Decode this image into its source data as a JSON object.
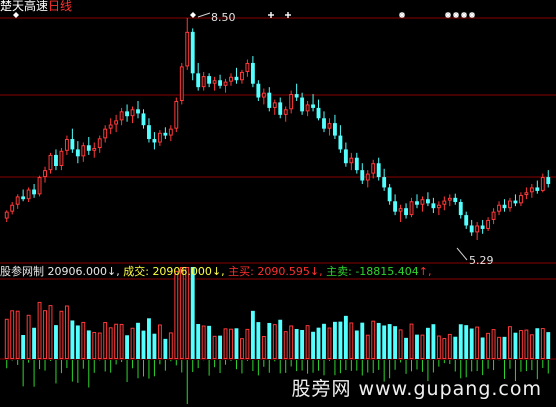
{
  "title": {
    "stock": "楚天高速",
    "period": "日线"
  },
  "colors": {
    "up": "#ff3a3a",
    "down": "#54ffff",
    "grid": "#8a0000",
    "pos_flow": "#ff3a3a",
    "neg_flow": "#2fd52f"
  },
  "annotations": {
    "high_label": "8.50",
    "low_label": "5.29"
  },
  "indicator": {
    "name": "股参网制",
    "v1_value": "20906.000",
    "v1_arrow": "↓",
    "v2_label": "成交:",
    "v2_value": "20906.000",
    "v2_arrow": "↓",
    "v3_label": "主买:",
    "v3_value": "2090.595",
    "v3_arrow": "↓",
    "v4_label": "主卖:",
    "v4_value": "-18815.404",
    "v4_arrow": "↑"
  },
  "watermark": "股旁网 www.gupang.com",
  "chart_data": {
    "type": "candlestick",
    "price_high": 8.5,
    "price_low": 5.29,
    "signals": "white markers above candles at top of chart",
    "candles": [
      [
        5.6,
        5.72,
        5.55,
        5.7
      ],
      [
        5.7,
        5.84,
        5.66,
        5.8
      ],
      [
        5.8,
        5.95,
        5.74,
        5.92
      ],
      [
        5.92,
        6.02,
        5.85,
        5.88
      ],
      [
        5.88,
        6.05,
        5.84,
        6.02
      ],
      [
        6.02,
        6.1,
        5.9,
        5.95
      ],
      [
        5.95,
        6.22,
        5.92,
        6.2
      ],
      [
        6.2,
        6.35,
        6.12,
        6.3
      ],
      [
        6.3,
        6.55,
        6.25,
        6.52
      ],
      [
        6.52,
        6.6,
        6.3,
        6.36
      ],
      [
        6.36,
        6.62,
        6.3,
        6.58
      ],
      [
        6.58,
        6.8,
        6.52,
        6.75
      ],
      [
        6.75,
        6.9,
        6.55,
        6.6
      ],
      [
        6.6,
        6.72,
        6.4,
        6.5
      ],
      [
        6.5,
        6.7,
        6.42,
        6.66
      ],
      [
        6.66,
        6.78,
        6.52,
        6.58
      ],
      [
        6.58,
        6.7,
        6.48,
        6.62
      ],
      [
        6.62,
        6.8,
        6.55,
        6.76
      ],
      [
        6.76,
        6.95,
        6.7,
        6.9
      ],
      [
        6.9,
        7.05,
        6.82,
        6.96
      ],
      [
        6.96,
        7.1,
        6.85,
        7.02
      ],
      [
        7.02,
        7.2,
        6.95,
        7.15
      ],
      [
        7.15,
        7.25,
        7.0,
        7.08
      ],
      [
        7.08,
        7.22,
        6.98,
        7.18
      ],
      [
        7.18,
        7.3,
        7.05,
        7.12
      ],
      [
        7.12,
        7.18,
        6.9,
        6.95
      ],
      [
        6.95,
        7.05,
        6.7,
        6.75
      ],
      [
        6.75,
        6.85,
        6.6,
        6.7
      ],
      [
        6.7,
        6.88,
        6.65,
        6.84
      ],
      [
        6.84,
        6.92,
        6.75,
        6.8
      ],
      [
        6.8,
        6.95,
        6.72,
        6.9
      ],
      [
        6.9,
        7.35,
        6.85,
        7.3
      ],
      [
        7.3,
        7.85,
        7.25,
        7.8
      ],
      [
        7.8,
        8.5,
        7.75,
        8.3
      ],
      [
        8.3,
        8.35,
        7.6,
        7.7
      ],
      [
        7.7,
        7.85,
        7.45,
        7.5
      ],
      [
        7.5,
        7.72,
        7.45,
        7.66
      ],
      [
        7.66,
        7.7,
        7.5,
        7.55
      ],
      [
        7.55,
        7.65,
        7.45,
        7.6
      ],
      [
        7.6,
        7.68,
        7.48,
        7.52
      ],
      [
        7.52,
        7.62,
        7.42,
        7.58
      ],
      [
        7.58,
        7.7,
        7.52,
        7.65
      ],
      [
        7.65,
        7.78,
        7.55,
        7.6
      ],
      [
        7.6,
        7.75,
        7.55,
        7.72
      ],
      [
        7.72,
        7.9,
        7.65,
        7.85
      ],
      [
        7.85,
        7.95,
        7.5,
        7.55
      ],
      [
        7.55,
        7.6,
        7.3,
        7.35
      ],
      [
        7.35,
        7.48,
        7.25,
        7.42
      ],
      [
        7.42,
        7.5,
        7.15,
        7.2
      ],
      [
        7.2,
        7.32,
        7.1,
        7.28
      ],
      [
        7.28,
        7.35,
        7.05,
        7.1
      ],
      [
        7.1,
        7.22,
        7.0,
        7.18
      ],
      [
        7.18,
        7.45,
        7.12,
        7.4
      ],
      [
        7.4,
        7.55,
        7.3,
        7.35
      ],
      [
        7.35,
        7.42,
        7.1,
        7.15
      ],
      [
        7.15,
        7.3,
        7.08,
        7.25
      ],
      [
        7.25,
        7.4,
        7.15,
        7.2
      ],
      [
        7.2,
        7.32,
        7.02,
        7.05
      ],
      [
        7.05,
        7.15,
        6.85,
        6.9
      ],
      [
        6.9,
        7.05,
        6.8,
        6.98
      ],
      [
        6.98,
        7.1,
        6.75,
        6.8
      ],
      [
        6.8,
        6.95,
        6.55,
        6.6
      ],
      [
        6.6,
        6.7,
        6.35,
        6.4
      ],
      [
        6.4,
        6.55,
        6.3,
        6.48
      ],
      [
        6.48,
        6.55,
        6.25,
        6.3
      ],
      [
        6.3,
        6.4,
        6.1,
        6.15
      ],
      [
        6.15,
        6.3,
        6.05,
        6.25
      ],
      [
        6.25,
        6.45,
        6.18,
        6.4
      ],
      [
        6.4,
        6.48,
        6.15,
        6.2
      ],
      [
        6.2,
        6.32,
        6.0,
        6.05
      ],
      [
        6.05,
        6.1,
        5.8,
        5.85
      ],
      [
        5.85,
        5.95,
        5.65,
        5.7
      ],
      [
        5.7,
        5.8,
        5.55,
        5.75
      ],
      [
        5.75,
        5.82,
        5.6,
        5.65
      ],
      [
        5.65,
        5.9,
        5.62,
        5.85
      ],
      [
        5.85,
        5.95,
        5.75,
        5.8
      ],
      [
        5.8,
        5.92,
        5.7,
        5.88
      ],
      [
        5.88,
        5.98,
        5.78,
        5.82
      ],
      [
        5.82,
        5.9,
        5.68,
        5.75
      ],
      [
        5.75,
        5.85,
        5.65,
        5.8
      ],
      [
        5.8,
        5.92,
        5.72,
        5.86
      ],
      [
        5.86,
        5.95,
        5.78,
        5.9
      ],
      [
        5.9,
        5.96,
        5.8,
        5.84
      ],
      [
        5.84,
        5.88,
        5.6,
        5.65
      ],
      [
        5.65,
        5.7,
        5.45,
        5.5
      ],
      [
        5.5,
        5.58,
        5.35,
        5.4
      ],
      [
        5.4,
        5.55,
        5.29,
        5.5
      ],
      [
        5.5,
        5.58,
        5.38,
        5.45
      ],
      [
        5.45,
        5.62,
        5.42,
        5.58
      ],
      [
        5.58,
        5.75,
        5.52,
        5.7
      ],
      [
        5.7,
        5.85,
        5.65,
        5.8
      ],
      [
        5.8,
        5.88,
        5.7,
        5.75
      ],
      [
        5.75,
        5.9,
        5.7,
        5.86
      ],
      [
        5.86,
        5.95,
        5.78,
        5.82
      ],
      [
        5.82,
        5.98,
        5.78,
        5.94
      ],
      [
        5.94,
        6.05,
        5.88,
        5.98
      ],
      [
        5.98,
        6.1,
        5.9,
        6.05
      ],
      [
        6.05,
        6.15,
        5.96,
        6.0
      ],
      [
        6.0,
        6.25,
        5.98,
        6.2
      ],
      [
        6.2,
        6.3,
        6.05,
        6.1
      ]
    ]
  }
}
